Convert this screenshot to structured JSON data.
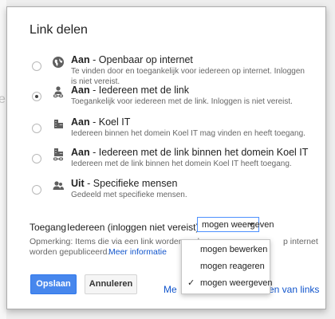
{
  "background": {
    "partial_letter": "e"
  },
  "dialog": {
    "title": "Link delen"
  },
  "options": [
    {
      "icon": "globe-icon",
      "title_bold": "Aan",
      "title_rest": " - Openbaar op internet",
      "description": "Te vinden door en toegankelijk voor iedereen op internet. Inloggen is niet vereist.",
      "selected": false
    },
    {
      "icon": "person-link-icon",
      "title_bold": "Aan",
      "title_rest": " - Iedereen met de link",
      "description": "Toegankelijk voor iedereen met de link. Inloggen is niet vereist.",
      "selected": true
    },
    {
      "icon": "building-icon",
      "title_bold": "Aan",
      "title_rest": " - Koel IT",
      "description": "Iedereen binnen het domein Koel IT mag vinden en heeft toegang.",
      "selected": false
    },
    {
      "icon": "building-link-icon",
      "title_bold": "Aan",
      "title_rest": " - Iedereen met de link binnen het domein Koel IT",
      "description": "Iedereen met de link binnen het domein Koel IT heeft toegang.",
      "selected": false
    },
    {
      "icon": "people-icon",
      "title_bold": "Uit",
      "title_rest": " - Specifieke mensen",
      "description": "Gedeeld met specifieke mensen.",
      "selected": false
    }
  ],
  "access": {
    "label": "Toegang",
    "value": "Iedereen (inloggen niet vereist)",
    "selected_permission": "mogen weergeven"
  },
  "note": {
    "text_left": "Opmerking: Items die via een link worden ged",
    "text_right": "p internet",
    "text_line2": "worden gepubliceerd.",
    "link": "Meer informatie"
  },
  "buttons": {
    "save": "Opslaan",
    "cancel": "Annuleren"
  },
  "bottom_links": {
    "left_fragment": "Me",
    "right_fragment": "en van links"
  },
  "dropdown": {
    "items": [
      {
        "label": "mogen bewerken",
        "checked": false
      },
      {
        "label": "mogen reageren",
        "checked": false
      },
      {
        "label": "mogen weergeven",
        "checked": true
      }
    ],
    "check_glyph": "✓"
  }
}
